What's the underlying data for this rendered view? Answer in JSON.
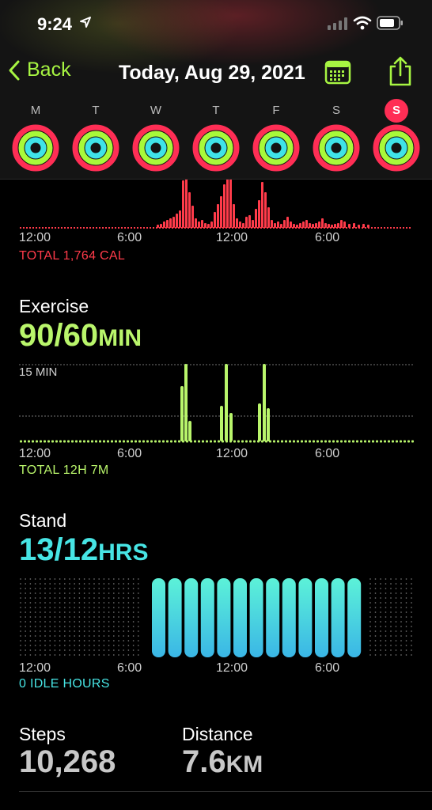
{
  "status_bar": {
    "time": "9:24"
  },
  "nav": {
    "back_label": "Back",
    "title": "Today, Aug 29, 2021"
  },
  "week": {
    "days": [
      "M",
      "T",
      "W",
      "T",
      "F",
      "S",
      "S"
    ],
    "selected_index": 6,
    "move_color": "#ff2e55",
    "exercise_color": "#a8f93a",
    "stand_color": "#3fe3e8"
  },
  "move": {
    "axis_labels": [
      "12:00",
      "6:00",
      "12:00",
      "6:00"
    ],
    "total": "TOTAL 1,764 CAL",
    "color": "#ff3b4a"
  },
  "exercise": {
    "label": "Exercise",
    "value": "90/60",
    "unit": "MIN",
    "grid_label": "15 MIN",
    "axis_labels": [
      "12:00",
      "6:00",
      "12:00",
      "6:00"
    ],
    "total": "TOTAL 12H 7M",
    "color": "#b9f56b"
  },
  "stand": {
    "label": "Stand",
    "value": "13/12",
    "unit": "HRS",
    "axis_labels": [
      "12:00",
      "6:00",
      "12:00",
      "6:00"
    ],
    "total": "0 IDLE HOURS",
    "color": "#47e5e5"
  },
  "steps": {
    "label": "Steps",
    "value": "10,268"
  },
  "distance": {
    "label": "Distance",
    "value": "7.6",
    "unit": "KM"
  }
}
